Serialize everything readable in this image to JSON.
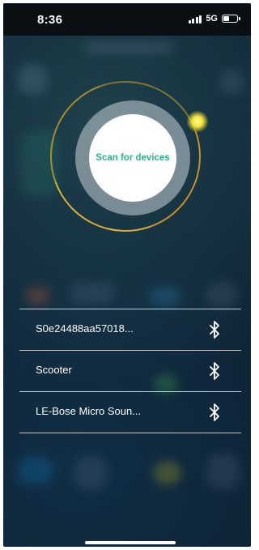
{
  "status_bar": {
    "time": "8:36",
    "network": "5G",
    "battery_level": 0.45
  },
  "scanner": {
    "button_label": "Scan for devices",
    "ring_color": "#d9b03a",
    "glow_color": "#f3e13a",
    "label_color": "#2bb38a"
  },
  "devices": [
    {
      "name": "S0e24488aa57018...",
      "icon": "bluetooth-icon"
    },
    {
      "name": "Scooter",
      "icon": "bluetooth-icon"
    },
    {
      "name": "LE-Bose Micro Soun...",
      "icon": "bluetooth-icon"
    }
  ]
}
